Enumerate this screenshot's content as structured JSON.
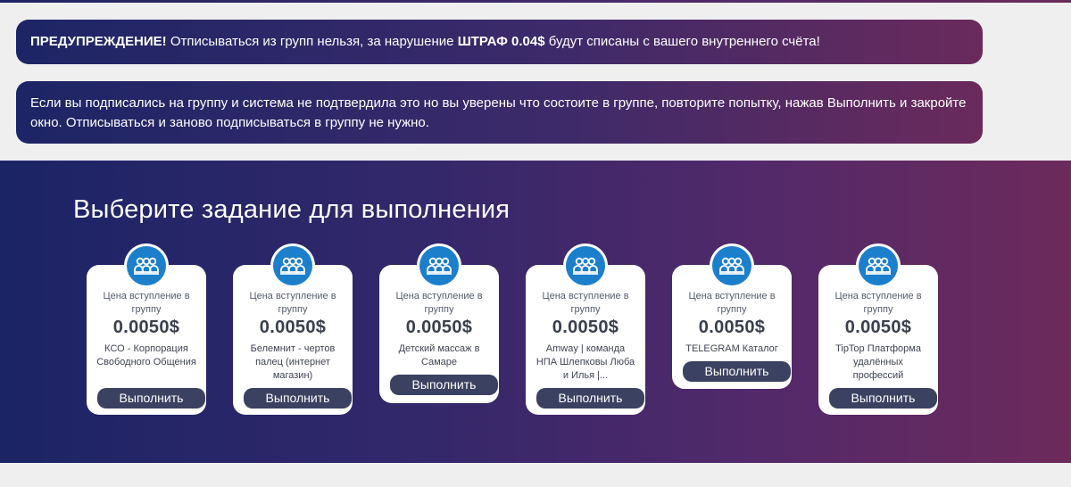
{
  "warning": {
    "label": "ПРЕДУПРЕЖДЕНИЕ!",
    "text_before": " Отписываться из групп нельзя, за нарушение ",
    "fine": "ШТРАФ 0.04$",
    "text_after": " будут списаны с вашего внутреннего счёта!"
  },
  "info": {
    "text": "Если вы подписались на группу и система не подтвердила это но вы уверены что состоите в группе, повторите попытку, нажав Выполнить и закройте окно. Отписываться и заново подписываться в группу не нужно."
  },
  "section": {
    "title": "Выберите задание для выполнения"
  },
  "tasks": [
    {
      "price_label": "Цена вступление в группу",
      "price": "0.0050$",
      "name": "КСО - Корпорация Свободного Общения",
      "button": "Выполнить"
    },
    {
      "price_label": "Цена вступление в группу",
      "price": "0.0050$",
      "name": "Белемнит - чертов палец (интернет магазин)",
      "button": "Выполнить"
    },
    {
      "price_label": "Цена вступление в группу",
      "price": "0.0050$",
      "name": "Детский массаж в Самаре",
      "button": "Выполнить"
    },
    {
      "price_label": "Цена вступление в группу",
      "price": "0.0050$",
      "name": "Amway | команда НПА Шлепковы Люба и Илья |...",
      "button": "Выполнить"
    },
    {
      "price_label": "Цена вступление в группу",
      "price": "0.0050$",
      "name": "TELEGRAM Каталог",
      "button": "Выполнить"
    },
    {
      "price_label": "Цена вступление в группу",
      "price": "0.0050$",
      "name": "TipTop Платформа удалённых профессий",
      "button": "Выполнить"
    }
  ],
  "icons": {
    "group": "group-icon"
  },
  "colors": {
    "accent_blue": "#1c7fcc",
    "button_bg": "#3b4160",
    "gradient_start": "#1b2466",
    "gradient_end": "#6d2a5b"
  }
}
